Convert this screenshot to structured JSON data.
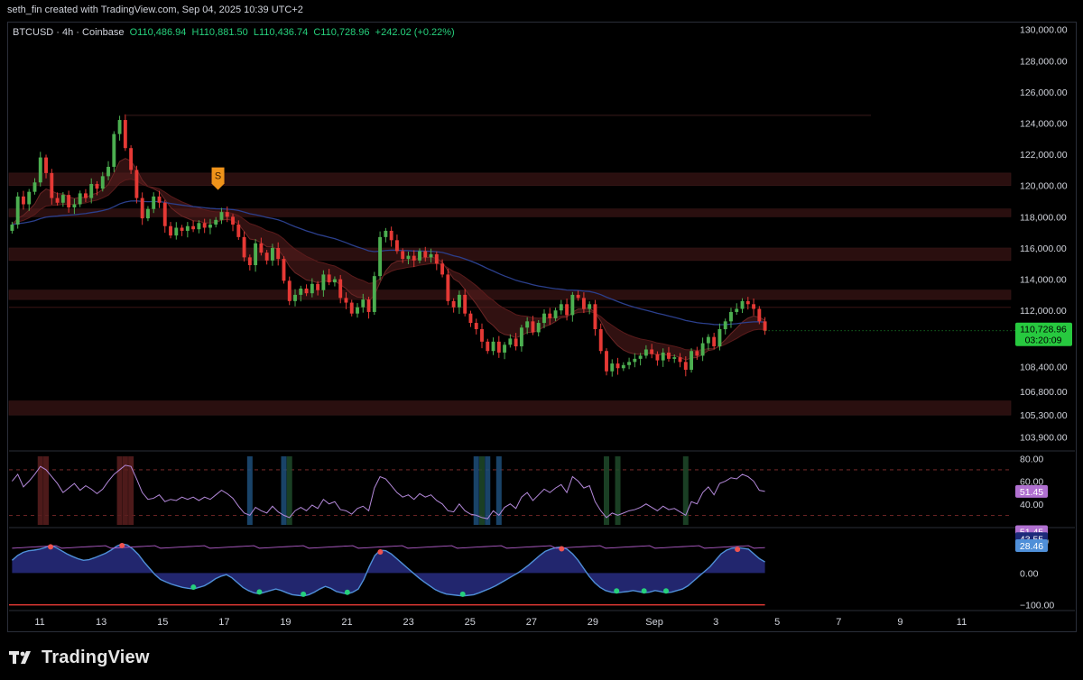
{
  "credit": "seth_fin created with TradingView.com, Sep 04, 2025 10:39 UTC+2",
  "legend": {
    "symbol": "BTCUSD · 4h · Coinbase",
    "open": "O110,486.94",
    "high": "H110,881.50",
    "low": "L110,436.74",
    "close": "C110,728.96",
    "change": "+242.02 (+0.22%)"
  },
  "brand": "TradingView",
  "colors": {
    "up": "#26a69a",
    "up_bright": "#4caf50",
    "down": "#e53935",
    "ma200": "#2b3f8c",
    "rsi": "#b388d9",
    "price_label": "#27c93f",
    "signal": "#f0931a"
  },
  "chart_data": [
    {
      "type": "candlestick",
      "timeframe": "4h",
      "ylim": [
        103000,
        130500
      ],
      "y_ticks": [
        130000,
        128000,
        126000,
        124000,
        122000,
        120000,
        118000,
        116000,
        114000,
        112000,
        108400,
        106800,
        105300,
        103900
      ],
      "y_tick_labels": [
        "130,000.00",
        "128,000.00",
        "126,000.00",
        "124,000.00",
        "122,000.00",
        "120,000.00",
        "118,000.00",
        "116,000.00",
        "114,000.00",
        "112,000.00",
        "108,400.00",
        "106,800.00",
        "105,300.00",
        "103,900.00"
      ],
      "x_ticks": [
        11,
        13,
        15,
        17,
        19,
        21,
        23,
        25,
        27,
        29,
        31,
        33,
        35,
        37,
        39,
        41
      ],
      "x_tick_labels": [
        "11",
        "13",
        "15",
        "17",
        "19",
        "21",
        "23",
        "25",
        "27",
        "29",
        "Sep",
        "3",
        "5",
        "7",
        "9",
        "11"
      ],
      "xlim": [
        10.0,
        42.6
      ],
      "last_price_label": "110,728.96",
      "countdown_label": "03:20:09",
      "signal_label": "S",
      "signal_x": 16.8,
      "zones": [
        {
          "from": 120000,
          "to": 120800
        },
        {
          "from": 118000,
          "to": 118500
        },
        {
          "from": 115200,
          "to": 116000
        },
        {
          "from": 112700,
          "to": 113300
        },
        {
          "from": 105300,
          "to": 106200
        }
      ],
      "closes": [
        117500,
        119300,
        118800,
        119600,
        120200,
        121800,
        120800,
        119200,
        118900,
        119400,
        118600,
        118800,
        119500,
        119200,
        120100,
        119800,
        120600,
        121200,
        123300,
        124200,
        122400,
        121000,
        119200,
        117900,
        118500,
        119300,
        118900,
        117400,
        116800,
        117300,
        117100,
        117400,
        117200,
        117600,
        117300,
        117500,
        117800,
        118300,
        118000,
        117500,
        116700,
        115400,
        114900,
        116300,
        115700,
        115200,
        116000,
        115300,
        113900,
        112600,
        113000,
        113400,
        113100,
        113700,
        113300,
        114300,
        113800,
        114000,
        112800,
        112500,
        111800,
        112200,
        112700,
        111900,
        114200,
        116700,
        117100,
        116500,
        115800,
        115300,
        115500,
        115200,
        115800,
        115400,
        115600,
        115000,
        114300,
        112600,
        112200,
        113000,
        111800,
        111200,
        110800,
        110000,
        109400,
        110000,
        109300,
        109800,
        110200,
        109700,
        110900,
        111300,
        110600,
        111200,
        111800,
        111500,
        112000,
        112400,
        111700,
        113000,
        112800,
        112100,
        112400,
        110800,
        109400,
        108100,
        108600,
        108300,
        108500,
        108700,
        108900,
        109100,
        109500,
        109200,
        108800,
        109300,
        108900,
        109000,
        108700,
        108200,
        109400,
        109100,
        109900,
        110300,
        109700,
        110800,
        111300,
        111900,
        112100,
        112600,
        112400,
        112100,
        111300,
        110700
      ]
    },
    {
      "type": "line",
      "name": "",
      "ylim": [
        20,
        85
      ],
      "y_ticks": [
        80,
        60,
        40
      ],
      "y_tick_labels": [
        "80.00",
        "60.00",
        "40.00"
      ],
      "levels": [
        70,
        30
      ],
      "last_value_label": "51.45",
      "values": [
        60,
        66,
        55,
        60,
        66,
        73,
        70,
        64,
        58,
        50,
        54,
        58,
        52,
        56,
        53,
        49,
        53,
        60,
        66,
        70,
        74,
        73,
        62,
        50,
        44,
        45,
        48,
        42,
        44,
        43,
        46,
        44,
        46,
        43,
        46,
        44,
        48,
        52,
        49,
        45,
        38,
        32,
        30,
        37,
        34,
        32,
        38,
        33,
        30,
        28,
        34,
        37,
        34,
        39,
        36,
        44,
        40,
        42,
        35,
        34,
        31,
        36,
        38,
        34,
        54,
        64,
        62,
        56,
        50,
        46,
        48,
        44,
        49,
        46,
        48,
        43,
        40,
        34,
        33,
        40,
        34,
        31,
        30,
        28,
        27,
        34,
        30,
        37,
        40,
        36,
        46,
        50,
        43,
        48,
        53,
        50,
        54,
        57,
        50,
        64,
        60,
        54,
        56,
        42,
        34,
        28,
        32,
        30,
        32,
        34,
        35,
        37,
        40,
        37,
        34,
        38,
        35,
        36,
        33,
        30,
        42,
        40,
        50,
        55,
        48,
        58,
        60,
        63,
        62,
        66,
        64,
        60,
        52,
        51
      ]
    },
    {
      "type": "area",
      "name": "",
      "ylim": [
        -115,
        140
      ],
      "y_ticks": [
        100,
        0,
        -100
      ],
      "y_tick_labels": [
        "100.00",
        "0.00",
        "−100.00"
      ],
      "value_labels": [
        "51.45",
        "43.55",
        "28.46"
      ],
      "values": [
        40,
        55,
        65,
        70,
        72,
        75,
        80,
        88,
        80,
        70,
        60,
        52,
        45,
        40,
        42,
        48,
        55,
        62,
        72,
        84,
        92,
        88,
        75,
        58,
        35,
        15,
        -5,
        -20,
        -28,
        -35,
        -40,
        -45,
        -48,
        -50,
        -45,
        -40,
        -30,
        -18,
        -10,
        -5,
        -15,
        -30,
        -45,
        -55,
        -62,
        -65,
        -60,
        -55,
        -50,
        -55,
        -62,
        -68,
        -70,
        -72,
        -68,
        -60,
        -50,
        -42,
        -48,
        -58,
        -62,
        -66,
        -60,
        -50,
        -20,
        20,
        55,
        72,
        70,
        60,
        45,
        30,
        15,
        0,
        -15,
        -28,
        -40,
        -52,
        -60,
        -66,
        -68,
        -70,
        -72,
        -70,
        -68,
        -62,
        -55,
        -48,
        -40,
        -30,
        -20,
        -10,
        0,
        12,
        25,
        40,
        55,
        68,
        75,
        80,
        82,
        75,
        60,
        40,
        15,
        -10,
        -30,
        -45,
        -55,
        -60,
        -62,
        -60,
        -58,
        -55,
        -58,
        -62,
        -60,
        -55,
        -58,
        -62,
        -60,
        -55,
        -50,
        -40,
        -25,
        -10,
        5,
        20,
        40,
        60,
        72,
        78,
        80,
        78,
        75,
        60,
        45,
        35
      ]
    }
  ]
}
